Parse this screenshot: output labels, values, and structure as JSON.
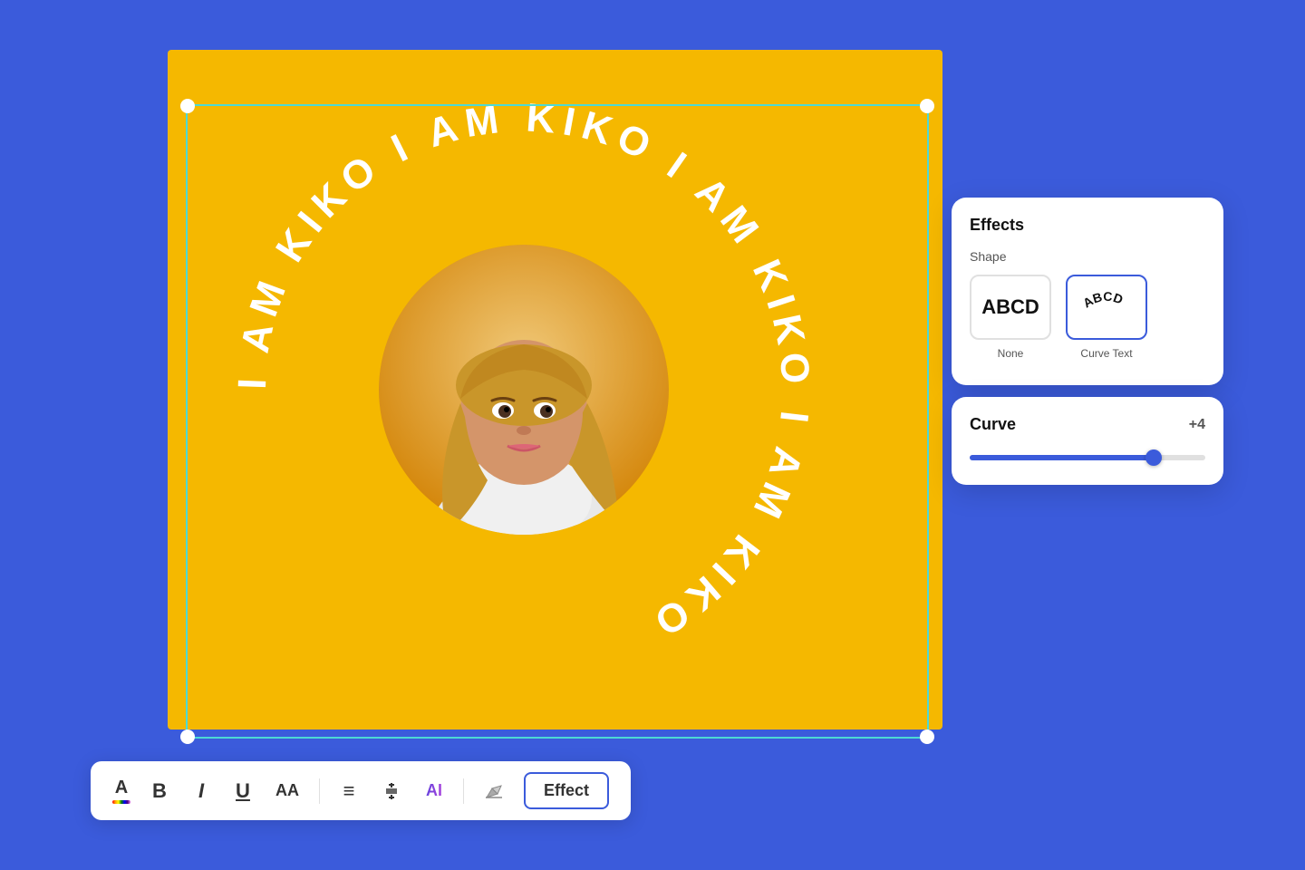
{
  "background_color": "#3B5BDB",
  "canvas": {
    "background": "#F5B800",
    "text": "I AM KIKO I AM KIKO I AM KIKO I AM KIKO "
  },
  "toolbar": {
    "font_color_letter": "A",
    "bold_label": "B",
    "italic_label": "I",
    "underline_label": "U",
    "font_size_label": "AA",
    "align_label": "≡",
    "line_height_label": "↕",
    "ai_label": "AI",
    "eraser_label": "✏",
    "effect_label": "Effect"
  },
  "effects_panel": {
    "title": "Effects",
    "shape_section": "Shape",
    "shape_none_label": "None",
    "shape_none_text": "ABCD",
    "shape_curve_label": "Curve Text",
    "shape_curve_text": "ABCD"
  },
  "curve_panel": {
    "title": "Curve",
    "value": "+4",
    "slider_percent": 78
  }
}
